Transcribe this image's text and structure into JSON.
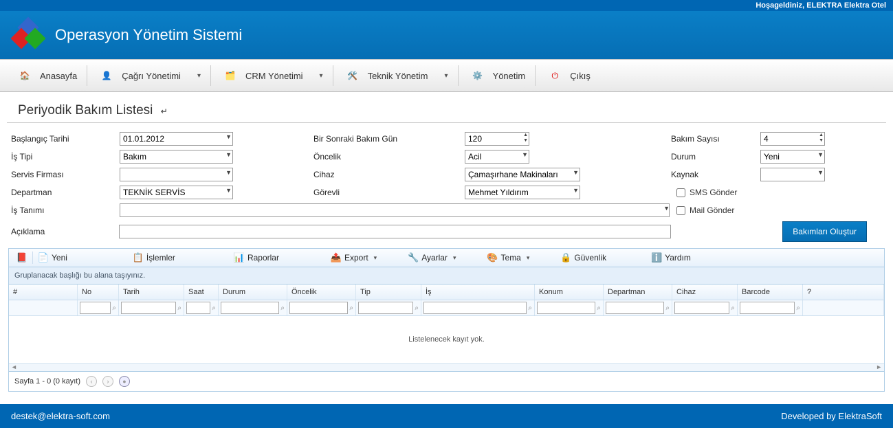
{
  "topbar": {
    "welcome": "Hoşageldiniz, ELEKTRA Elektra Otel"
  },
  "header": {
    "title": "Operasyon Yönetim Sistemi"
  },
  "nav": {
    "home": "Anasayfa",
    "call": "Çağrı Yönetimi",
    "crm": "CRM Yönetimi",
    "tech": "Teknik Yönetim",
    "admin": "Yönetim",
    "exit": "Çıkış"
  },
  "page": {
    "title": "Periyodik Bakım Listesi"
  },
  "form": {
    "labels": {
      "baslangic": "Başlangıç Tarihi",
      "istipi": "İş Tipi",
      "servis": "Servis Firması",
      "departman": "Departman",
      "istanimi": "İş Tanımı",
      "aciklama": "Açıklama",
      "sonraki": "Bir Sonraki Bakım Gün",
      "oncelik": "Öncelik",
      "cihaz": "Cihaz",
      "gorevli": "Görevli",
      "bakimsayisi": "Bakım Sayısı",
      "durum": "Durum",
      "kaynak": "Kaynak",
      "sms": "SMS Gönder",
      "mail": "Mail Gönder"
    },
    "values": {
      "baslangic": "01.01.2012",
      "istipi": "Bakım",
      "servis": "",
      "departman": "TEKNİK SERVİS",
      "istanimi": "",
      "aciklama": "",
      "sonraki": "120",
      "oncelik": "Acil",
      "cihaz": "Çamaşırhane Makinaları",
      "gorevli": "Mehmet Yıldırım",
      "bakimsayisi": "4",
      "durum": "Yeni",
      "kaynak": ""
    },
    "button": "Bakımları Oluştur"
  },
  "toolbar": {
    "yeni": "Yeni",
    "islemler": "İşlemler",
    "raporlar": "Raporlar",
    "export": "Export",
    "ayarlar": "Ayarlar",
    "tema": "Tema",
    "guvenlik": "Güvenlik",
    "yardim": "Yardım"
  },
  "grid": {
    "grouphint": "Gruplanacak başlığı bu alana taşıyınız.",
    "cols": {
      "hash": "#",
      "no": "No",
      "tarih": "Tarih",
      "saat": "Saat",
      "durum": "Durum",
      "oncelik": "Öncelik",
      "tip": "Tip",
      "is": "İş",
      "konum": "Konum",
      "departman": "Departman",
      "cihaz": "Cihaz",
      "barcode": "Barcode",
      "q": "?"
    },
    "empty": "Listelenecek kayıt yok.",
    "pager": "Sayfa 1 - 0 (0 kayıt)"
  },
  "footer": {
    "email": "destek@elektra-soft.com",
    "credit": "Developed by ElektraSoft"
  }
}
